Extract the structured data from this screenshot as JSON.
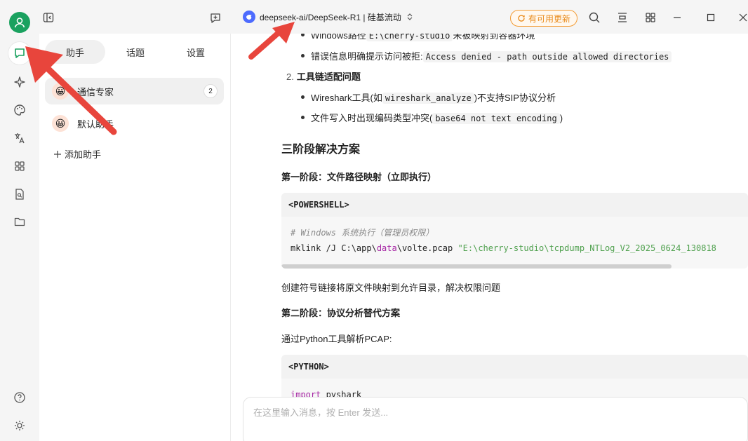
{
  "topbar": {
    "model_name": "deepseek-ai/DeepSeek-R1 | 硅基流动",
    "update_label": "有可用更新"
  },
  "panel": {
    "tabs": [
      "助手",
      "话题",
      "设置"
    ],
    "assistants": [
      {
        "name": "通信专家",
        "count": "2"
      },
      {
        "name": "默认助手",
        "count": ""
      }
    ],
    "add_label": "添加助手"
  },
  "chat": {
    "bullet1_prefix": "Windows路径",
    "bullet1_code": "E:\\cherry-studio",
    "bullet1_suffix": "未被映射到容器环境",
    "bullet2_prefix": "错误信息明确提示访问被拒:",
    "bullet2_code": "Access denied - path outside allowed directories",
    "item2_num": "2.",
    "item2_title": "工具链适配问题",
    "bullet3_prefix": "Wireshark工具(如",
    "bullet3_code": "wireshark_analyze",
    "bullet3_suffix": ")不支持SIP协议分析",
    "bullet4_prefix": "文件写入时出现编码类型冲突(",
    "bullet4_code": "base64 not text encoding",
    "bullet4_suffix": ")",
    "section_title": "三阶段解决方案",
    "phase1_title": "第一阶段：文件路径映射（立即执行）",
    "code1_lang": "<POWERSHELL>",
    "code1_comment": "# Windows 系统执行（管理员权限）",
    "code1_cmd_a": "mklink /J C:\\app\\",
    "code1_cmd_kw": "data",
    "code1_cmd_b": "\\volte.pcap ",
    "code1_cmd_str": "\"E:\\cherry-studio\\tcpdump_NTLog_V2_2025_0624_130818",
    "para1": "创建符号链接将原文件映射到允许目录，解决权限问题",
    "phase2_title": "第二阶段：协议分析替代方案",
    "para2": "通过Python工具解析PCAP:",
    "code2_lang": "<PYTHON>",
    "code2_kw": "import",
    "code2_rest": " pyshark"
  },
  "input": {
    "placeholder": "在这里输入消息，按 Enter 发送..."
  },
  "colors": {
    "accent": "#1aa15f",
    "update": "#e98a1a",
    "arrow": "#e8453c"
  }
}
